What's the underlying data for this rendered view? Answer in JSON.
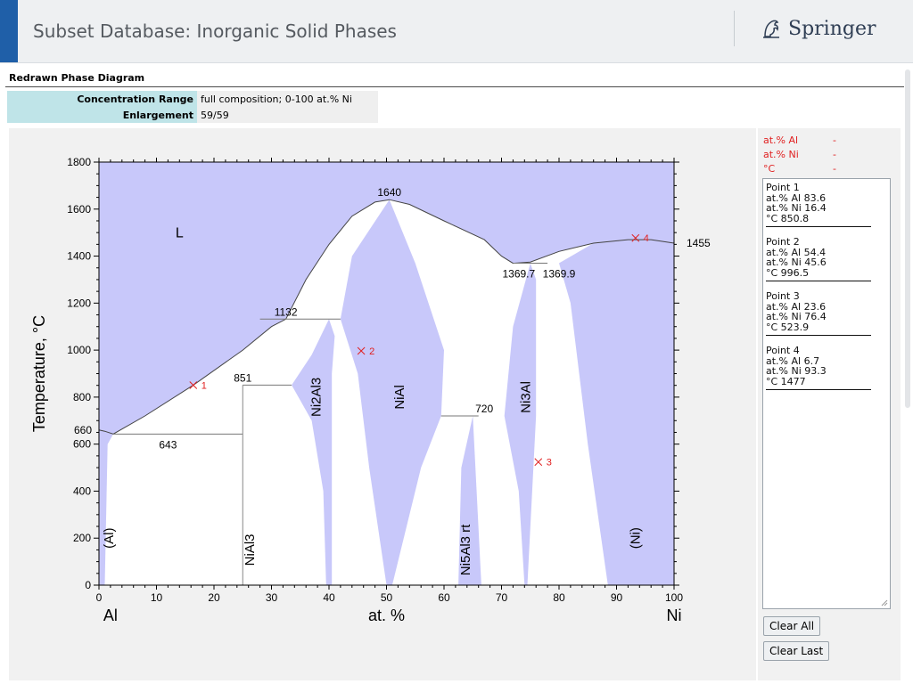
{
  "header": {
    "title": "Subset Database: Inorganic Solid Phases",
    "brand": "Springer",
    "brand_icon": "springer-horse-icon"
  },
  "section": {
    "title": "Redrawn Phase Diagram"
  },
  "info": [
    {
      "label": "Concentration Range",
      "value": "full composition; 0-100 at.% Ni"
    },
    {
      "label": "Enlargement",
      "value": "59/59"
    }
  ],
  "cursor": [
    {
      "label": "at.% Al",
      "value": "-"
    },
    {
      "label": "at.% Ni",
      "value": "-"
    },
    {
      "label": "°C",
      "value": "-"
    }
  ],
  "points": [
    {
      "name": "Point 1",
      "al": "at.% Al 83.6",
      "ni": "at.% Ni 16.4",
      "t": "°C 850.8"
    },
    {
      "name": "Point 2",
      "al": "at.% Al 54.4",
      "ni": "at.% Ni 45.6",
      "t": "°C 996.5"
    },
    {
      "name": "Point 3",
      "al": "at.% Al 23.6",
      "ni": "at.% Ni 76.4",
      "t": "°C 523.9"
    },
    {
      "name": "Point 4",
      "al": "at.% Al 6.7",
      "ni": "at.% Ni 93.3",
      "t": "°C 1477"
    }
  ],
  "buttons": {
    "clear_all": "Clear All",
    "clear_last": "Clear Last"
  },
  "colors": {
    "phase_fill": "#c8c8fa",
    "marker": "#e02020",
    "header_accent": "#1f5fa8",
    "label_bg": "#bfe4e8"
  },
  "chart_data": {
    "type": "phase-diagram",
    "xlabel": "at. %",
    "ylabel": "Temperature, °C",
    "x_left_element": "Al",
    "x_right_element": "Ni",
    "xlim": [
      0,
      100
    ],
    "ylim": [
      0,
      1800
    ],
    "x_ticks": [
      0,
      10,
      20,
      30,
      40,
      50,
      60,
      70,
      80,
      90,
      100
    ],
    "y_ticks": [
      0,
      200,
      400,
      600,
      800,
      1000,
      1200,
      1400,
      1600,
      1800
    ],
    "y_tick_labels": [
      "0",
      "200",
      "400",
      "600",
      "800",
      "1000",
      "1200",
      "1400",
      "1600",
      "1800"
    ],
    "x_tick_labels": [
      "0",
      "10",
      "20",
      "30",
      "40",
      "50",
      "60",
      "70",
      "80",
      "90",
      "100"
    ],
    "isotherm_labels": [
      {
        "text": "1640",
        "x": 50.5,
        "t": 1640
      },
      {
        "text": "1132",
        "x": 32.5,
        "t": 1132
      },
      {
        "text": "851",
        "x": 25,
        "t": 851
      },
      {
        "text": "660",
        "x": 0,
        "t": 660
      },
      {
        "text": "643",
        "x": 12,
        "t": 643
      },
      {
        "text": "720",
        "x": 67,
        "t": 720
      },
      {
        "text": "1369.7",
        "x": 73,
        "t": 1369.7
      },
      {
        "text": "1369.9",
        "x": 80,
        "t": 1369.9
      },
      {
        "text": "1455",
        "x": 100,
        "t": 1455
      }
    ],
    "phase_labels": [
      {
        "text": "L",
        "x": 14,
        "t": 1480
      },
      {
        "text": "(Al)",
        "x": 2.5,
        "t": 200
      },
      {
        "text": "NiAl3",
        "x": 27,
        "t": 150
      },
      {
        "text": "Ni2Al3",
        "x": 38.5,
        "t": 800
      },
      {
        "text": "NiAl",
        "x": 53,
        "t": 800
      },
      {
        "text": "Ni5Al3 rt",
        "x": 64.5,
        "t": 150
      },
      {
        "text": "Ni3Al",
        "x": 75,
        "t": 800
      },
      {
        "text": "(Ni)",
        "x": 94,
        "t": 200
      }
    ],
    "points": [
      {
        "label": "1",
        "x": 16.4,
        "t": 850.8
      },
      {
        "label": "2",
        "x": 45.6,
        "t": 996.5
      },
      {
        "label": "3",
        "x": 76.4,
        "t": 523.9
      },
      {
        "label": "4",
        "x": 93.3,
        "t": 1477
      }
    ]
  }
}
